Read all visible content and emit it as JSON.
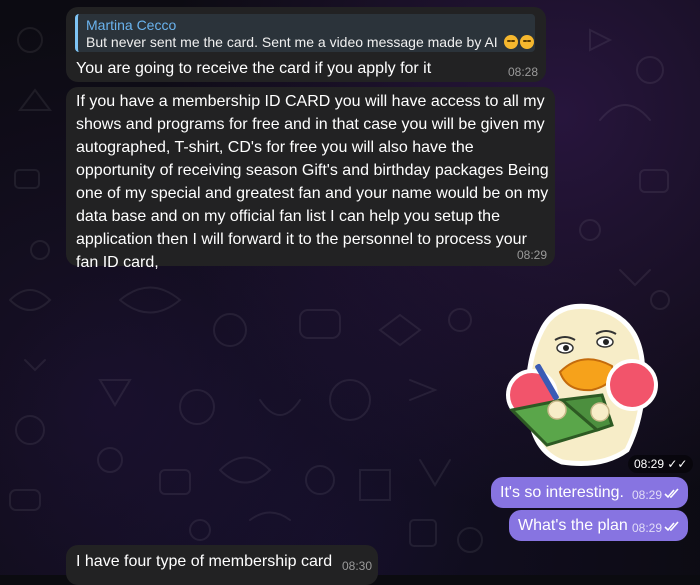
{
  "chat": {
    "messages": [
      {
        "direction": "incoming",
        "reply_to": {
          "sender": "Martina Cecco",
          "text": "But never sent me the card. Sent me a video message made by AI",
          "emojis": [
            "grinning-sweat-emoji",
            "grinning-sweat-emoji"
          ]
        },
        "text": "You are going to receive the card if you apply for it",
        "time": "08:28"
      },
      {
        "direction": "incoming",
        "text": "If you have a membership ID CARD you will have access to all my shows and programs for free and in that case you will be given my autographed, T-shirt, CD's for free you will also have the opportunity of receiving season Gift's and birthday packages Being one of my special and greatest fan and your name would be on my data base and on my official fan list I can help you setup the application then I will forward it to the personnel to process your fan ID card,",
        "time": "08:29"
      },
      {
        "direction": "outgoing",
        "type": "sticker",
        "sticker": "duck-reading-book-sticker",
        "time": "08:29",
        "status": "read"
      },
      {
        "direction": "outgoing",
        "text": "It's so interesting.",
        "time": "08:29",
        "status": "read"
      },
      {
        "direction": "outgoing",
        "text": "What's the plan",
        "time": "08:29",
        "status": "read"
      },
      {
        "direction": "incoming",
        "text": "I have four type of membership card",
        "time": "08:30"
      }
    ]
  },
  "colors": {
    "incoming_bubble": "#222223",
    "outgoing_bubble": "#8774e1",
    "reply_accent": "#6ab3ee",
    "background": "#0c0b12"
  }
}
